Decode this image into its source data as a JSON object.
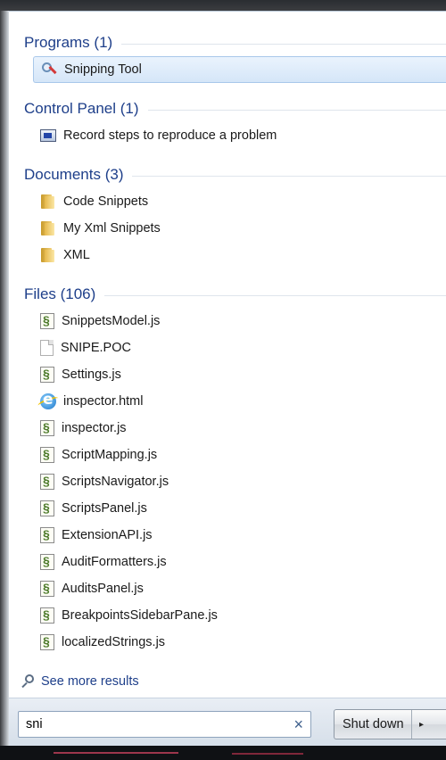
{
  "sections": {
    "programs": {
      "header": "Programs (1)",
      "items": [
        {
          "label": "Snipping Tool",
          "icon": "scissors-icon"
        }
      ]
    },
    "control_panel": {
      "header": "Control Panel (1)",
      "items": [
        {
          "label": "Record steps to reproduce a problem",
          "icon": "steps-recorder-icon"
        }
      ]
    },
    "documents": {
      "header": "Documents (3)",
      "items": [
        {
          "label": "Code Snippets",
          "icon": "folder-icon"
        },
        {
          "label": "My Xml Snippets",
          "icon": "folder-icon"
        },
        {
          "label": "XML",
          "icon": "folder-icon"
        }
      ]
    },
    "files": {
      "header": "Files (106)",
      "items": [
        {
          "label": "SnippetsModel.js",
          "icon": "js-file-icon"
        },
        {
          "label": "SNIPE.POC",
          "icon": "blank-file-icon"
        },
        {
          "label": "Settings.js",
          "icon": "js-file-icon"
        },
        {
          "label": "inspector.html",
          "icon": "ie-icon"
        },
        {
          "label": "inspector.js",
          "icon": "js-file-icon"
        },
        {
          "label": "ScriptMapping.js",
          "icon": "js-file-icon"
        },
        {
          "label": "ScriptsNavigator.js",
          "icon": "js-file-icon"
        },
        {
          "label": "ScriptsPanel.js",
          "icon": "js-file-icon"
        },
        {
          "label": "ExtensionAPI.js",
          "icon": "js-file-icon"
        },
        {
          "label": "AuditFormatters.js",
          "icon": "js-file-icon"
        },
        {
          "label": "AuditsPanel.js",
          "icon": "js-file-icon"
        },
        {
          "label": "BreakpointsSidebarPane.js",
          "icon": "js-file-icon"
        },
        {
          "label": "localizedStrings.js",
          "icon": "js-file-icon"
        }
      ]
    }
  },
  "see_more": {
    "label": "See more results",
    "icon": "search-icon"
  },
  "search": {
    "value": "sni",
    "clear_glyph": "×"
  },
  "shutdown": {
    "label": "Shut down",
    "arrow_glyph": "▸"
  },
  "colors": {
    "accent": "#1e3f8a",
    "selection": "#d5e6f8"
  }
}
